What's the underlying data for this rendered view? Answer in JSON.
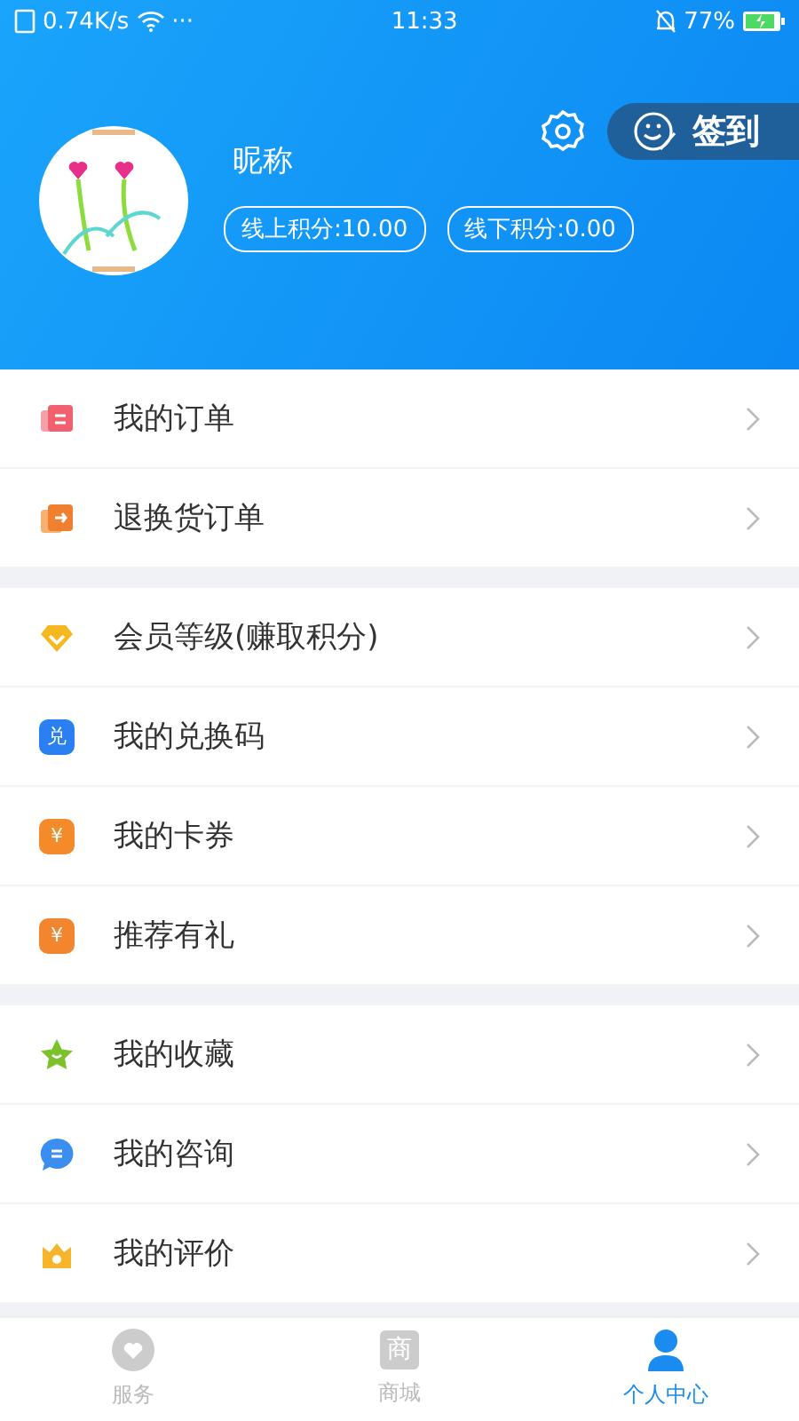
{
  "status_bar": {
    "speed": "0.74K/s",
    "dots": "···",
    "time": "11:33",
    "battery": "77%"
  },
  "profile": {
    "nickname": "昵称",
    "points": [
      "线上积分:10.00",
      "线下积分:0.00"
    ],
    "checkin": "签到"
  },
  "groups": [
    {
      "items": [
        {
          "label": "我的订单",
          "kind": "order"
        },
        {
          "label": "退换货订单",
          "kind": "return"
        }
      ]
    },
    {
      "items": [
        {
          "label": "会员等级(赚取积分)",
          "kind": "diamond"
        },
        {
          "label": "我的兑换码",
          "kind": "code",
          "glyph": "兑"
        },
        {
          "label": "我的卡券",
          "kind": "coupon",
          "glyph": "¥"
        },
        {
          "label": "推荐有礼",
          "kind": "gift",
          "glyph": "¥"
        }
      ]
    },
    {
      "items": [
        {
          "label": "我的收藏",
          "kind": "star"
        },
        {
          "label": "我的咨询",
          "kind": "chat"
        },
        {
          "label": "我的评价",
          "kind": "review"
        }
      ]
    }
  ],
  "tabs": [
    {
      "label": "服务",
      "kind": "heart",
      "selected": false
    },
    {
      "label": "商城",
      "kind": "shop",
      "glyph": "商",
      "selected": false
    },
    {
      "label": "个人中心",
      "kind": "person",
      "selected": true
    }
  ]
}
